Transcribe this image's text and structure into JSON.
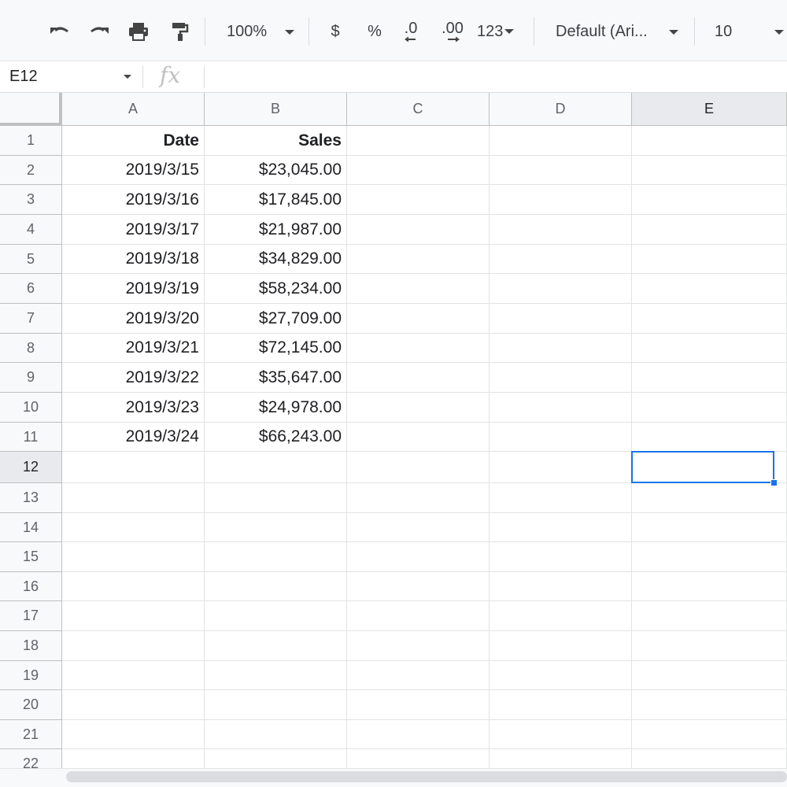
{
  "toolbar": {
    "zoom": "100%",
    "currency_label": "$",
    "percent_label": "%",
    "decrease_decimal_label": ".0",
    "increase_decimal_label": ".00",
    "more_formats_label": "123",
    "font_family": "Default (Ari...",
    "font_size": "10"
  },
  "formula_bar": {
    "name_box": "E12",
    "fx_label": "fx"
  },
  "grid": {
    "column_headers": [
      "A",
      "B",
      "C",
      "D",
      "E"
    ],
    "row_headers": [
      "1",
      "2",
      "3",
      "4",
      "5",
      "6",
      "7",
      "8",
      "9",
      "10",
      "11",
      "12",
      "13",
      "14",
      "15",
      "16",
      "17",
      "18",
      "19",
      "20",
      "21",
      "22"
    ],
    "rows": [
      [
        "Date",
        "Sales",
        "",
        "",
        ""
      ],
      [
        "2019/3/15",
        "$23,045.00",
        "",
        "",
        ""
      ],
      [
        "2019/3/16",
        "$17,845.00",
        "",
        "",
        ""
      ],
      [
        "2019/3/17",
        "$21,987.00",
        "",
        "",
        ""
      ],
      [
        "2019/3/18",
        "$34,829.00",
        "",
        "",
        ""
      ],
      [
        "2019/3/19",
        "$58,234.00",
        "",
        "",
        ""
      ],
      [
        "2019/3/20",
        "$27,709.00",
        "",
        "",
        ""
      ],
      [
        "2019/3/21",
        "$72,145.00",
        "",
        "",
        ""
      ],
      [
        "2019/3/22",
        "$35,647.00",
        "",
        "",
        ""
      ],
      [
        "2019/3/23",
        "$24,978.00",
        "",
        "",
        ""
      ],
      [
        "2019/3/24",
        "$66,243.00",
        "",
        "",
        ""
      ]
    ],
    "selected_cell": "E12",
    "selection_color": "#1a73e8"
  }
}
